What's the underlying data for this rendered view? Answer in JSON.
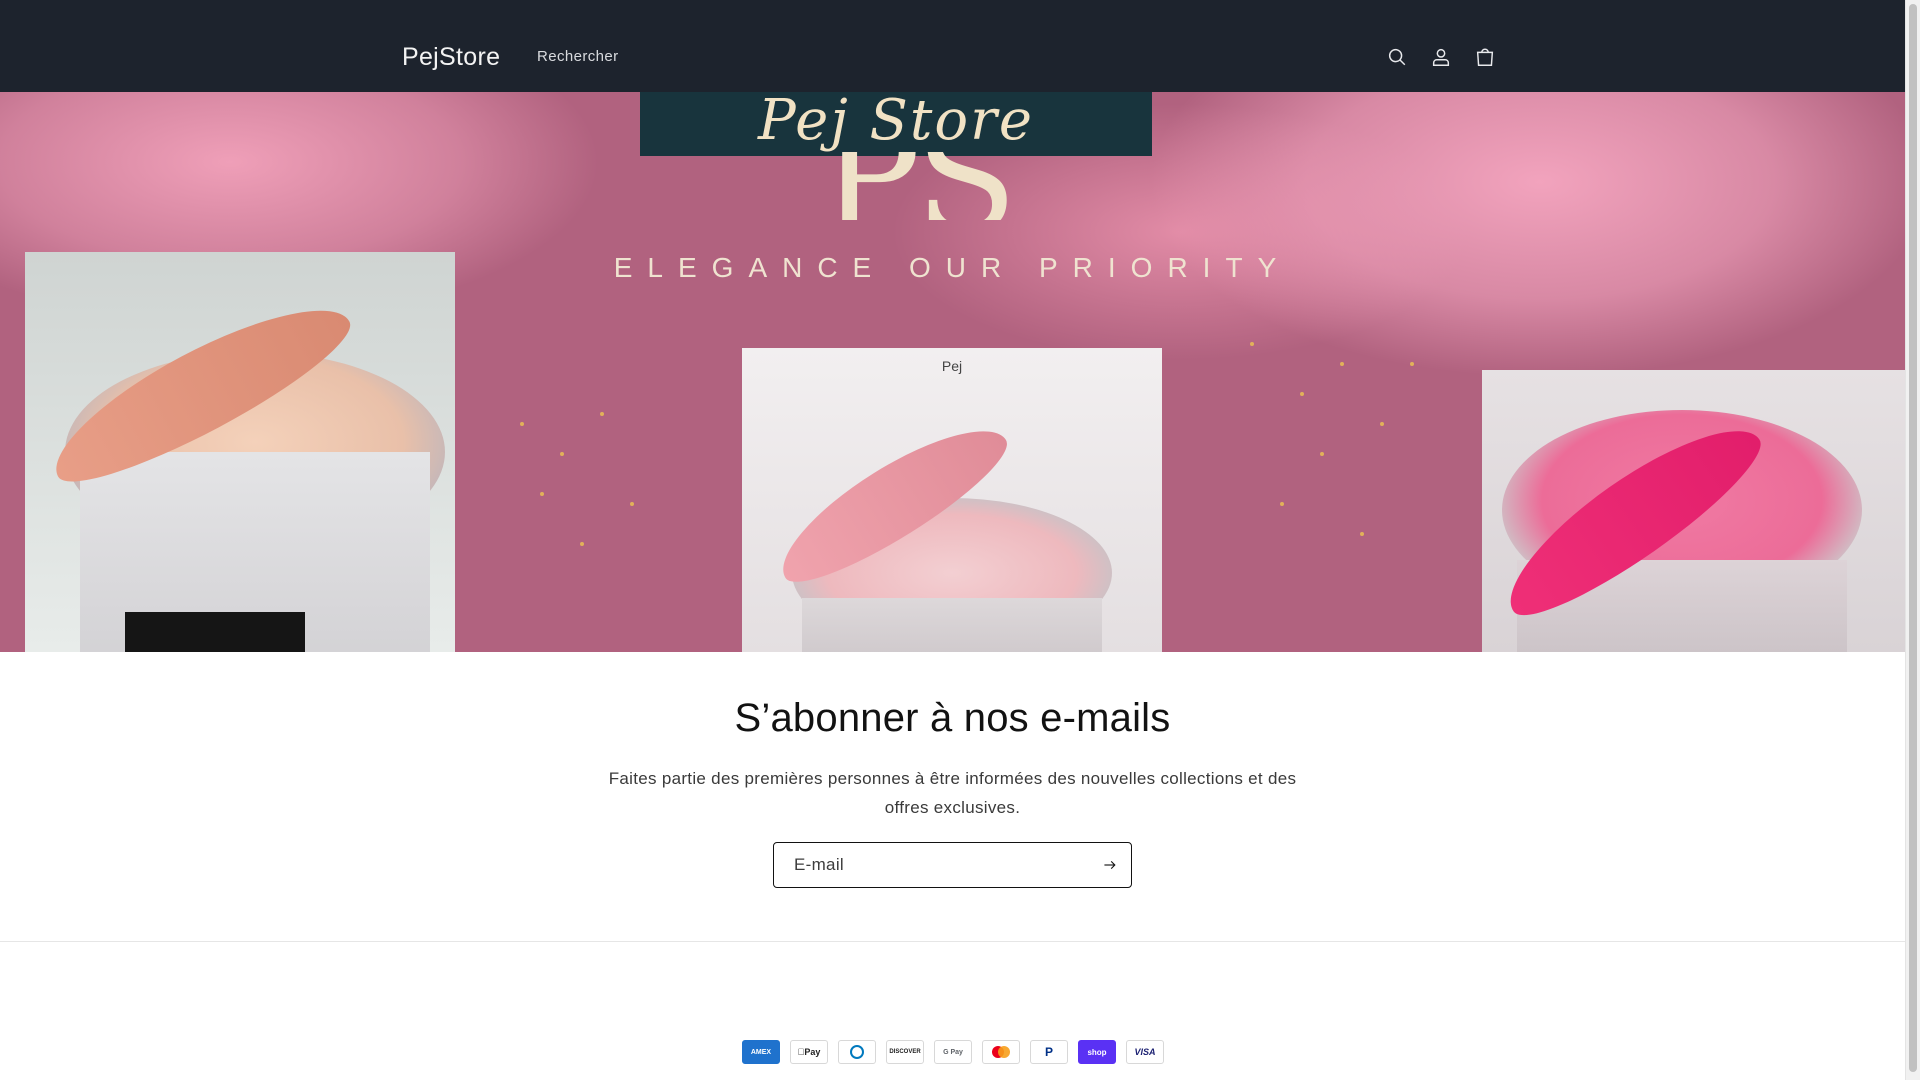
{
  "header": {
    "logo": "PejStore",
    "nav": [
      {
        "label": "Rechercher"
      }
    ],
    "icons": [
      "search-icon",
      "account-icon",
      "cart-icon"
    ],
    "bg_color": "#1d232d"
  },
  "hero": {
    "banner_script": "Pej Store",
    "tagline": "ELEGANCE OUR PRIORITY",
    "jar_label": "Pej",
    "colors": {
      "background": "#b1627f",
      "banner": "#18343d"
    }
  },
  "newsletter": {
    "title": "S’abonner à nos e-mails",
    "description": "Faites partie des premières personnes à être informées des nouvelles collections et des offres exclusives.",
    "email_placeholder": "E-mail",
    "submit_icon": "arrow-right-icon"
  },
  "footer": {
    "payment_methods": [
      "American Express",
      "Apple Pay",
      "Diners Club",
      "Discover",
      "Google Pay",
      "Mastercard",
      "PayPal",
      "Shop Pay",
      "Visa"
    ]
  }
}
